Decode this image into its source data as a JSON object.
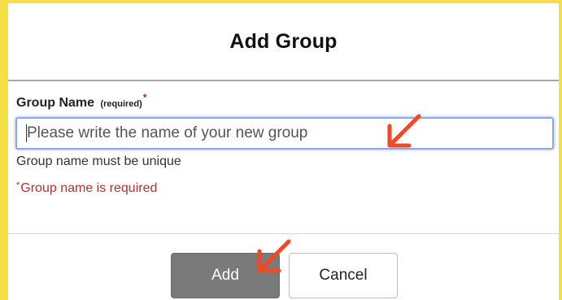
{
  "dialog": {
    "title": "Add Group"
  },
  "field": {
    "label": "Group Name",
    "required_note": "(required)",
    "asterisk": "*",
    "placeholder": "Please write the name of your new group",
    "value": "",
    "hint": "Group name must be unique",
    "error_asterisk": "*",
    "error": "Group name is required"
  },
  "buttons": {
    "add_label": "Add",
    "cancel_label": "Cancel"
  },
  "colors": {
    "background": "#f3df46",
    "annotation_arrow": "#ee4b22",
    "error_text": "#b5322b",
    "add_button": "#7a7a7a"
  },
  "annotations": [
    {
      "icon": "arrow-down-left-icon",
      "points_to": "group-name-input"
    },
    {
      "icon": "arrow-down-left-icon",
      "points_to": "add-button"
    }
  ]
}
